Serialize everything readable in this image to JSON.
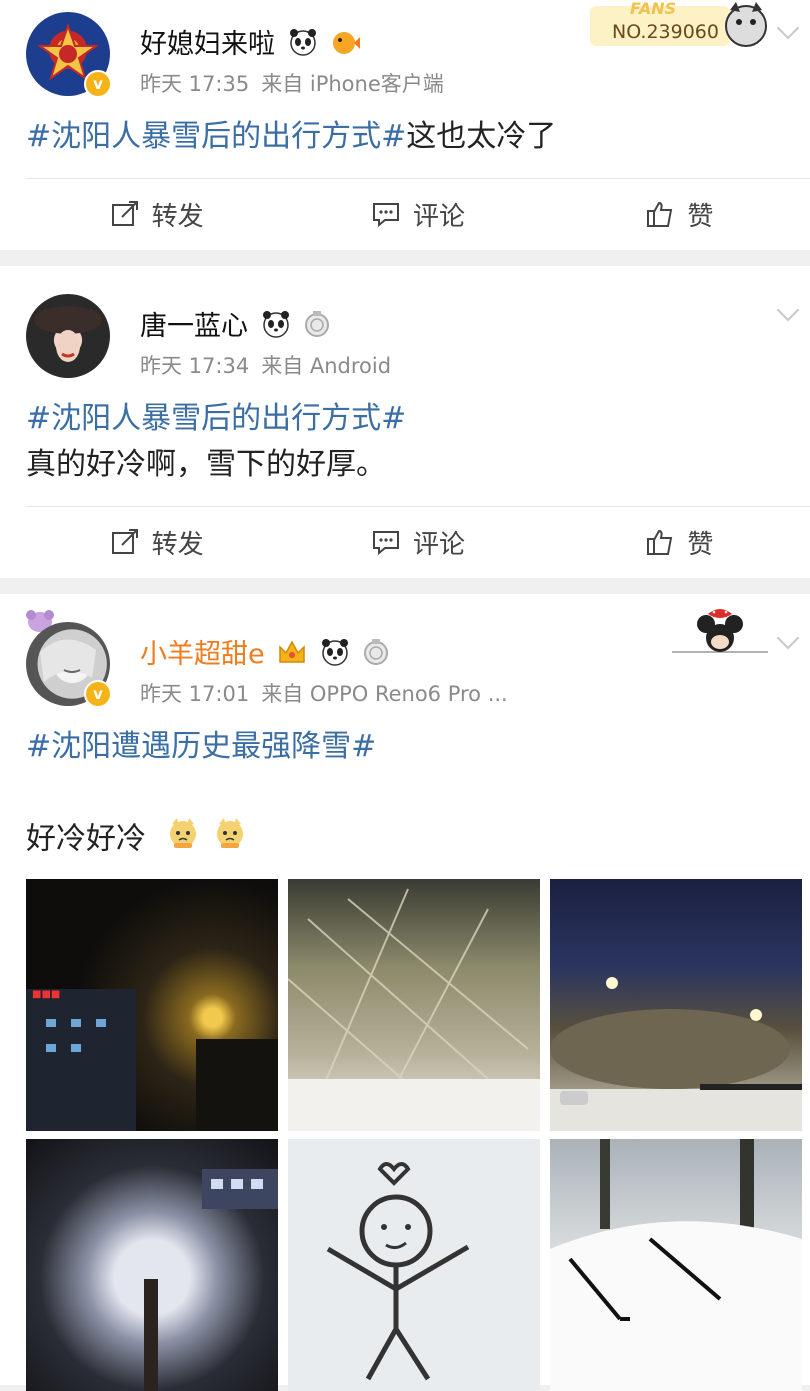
{
  "posts": [
    {
      "username": "好媳妇来啦",
      "time": "昨天 17:35",
      "source": "来自 iPhone客户端",
      "topic": "#沈阳人暴雪后的出行方式#",
      "text": "这也太冷了",
      "fans_badge": "NO.239060",
      "fans_word": "FANS"
    },
    {
      "username": "唐一蓝心",
      "time": "昨天 17:34",
      "source": "来自 Android",
      "topic": "#沈阳人暴雪后的出行方式#",
      "text": "真的好冷啊，雪下的好厚。"
    },
    {
      "username": "小羊超甜e",
      "time": "昨天 17:01",
      "source": "来自 OPPO Reno6 Pro ...",
      "topic": "#沈阳遭遇历史最强降雪#",
      "text": "好冷好冷"
    }
  ],
  "actions": {
    "repost": "转发",
    "comment": "评论",
    "like": "赞"
  },
  "colors": {
    "topic": "#3a6ea5",
    "vip_name": "#f07d1d",
    "verified": "#f6b318",
    "meta": "#8a8a8a"
  },
  "icons": [
    "repost-icon",
    "comment-icon",
    "like-icon",
    "chevron-down-icon",
    "panda-icon",
    "verified-badge-icon",
    "medal-icon",
    "crown-icon",
    "emoji-dog-icon"
  ]
}
